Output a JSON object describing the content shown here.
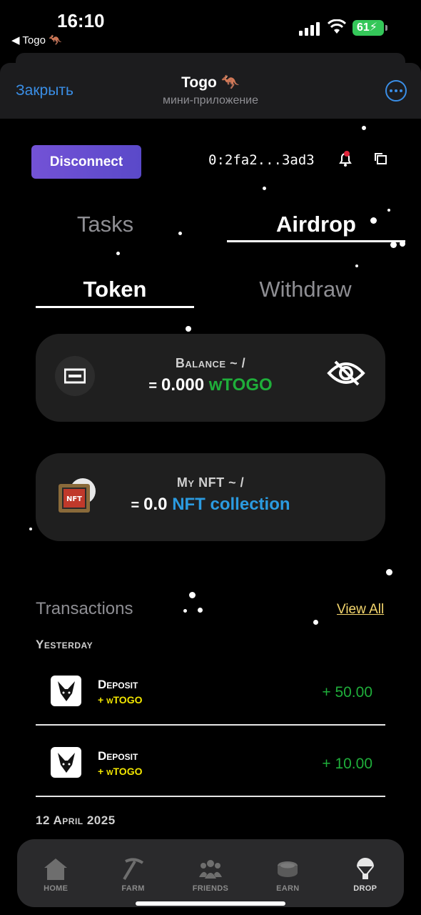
{
  "status_bar": {
    "time": "16:10",
    "back_app": "◀ Togo 🦘",
    "battery": "61"
  },
  "header": {
    "close_label": "Закрыть",
    "title": "Togo 🦘",
    "subtitle": "мини-приложение"
  },
  "wallet": {
    "disconnect_label": "Disconnect",
    "address": "0:2fa2...3ad3"
  },
  "tabs": {
    "tasks": "Tasks",
    "airdrop": "Airdrop"
  },
  "subtabs": {
    "token": "Token",
    "withdraw": "Withdraw"
  },
  "balance_card": {
    "label": "Balance ~ /",
    "eq": "=",
    "amount": "0.000",
    "unit": "wTOGO"
  },
  "nft_card": {
    "label": "My NFT ~ /",
    "eq": "=",
    "amount": "0.0",
    "unit": "NFT collection",
    "icon_text": "NFT"
  },
  "transactions": {
    "title": "Transactions",
    "view_all": "View All",
    "groups": [
      {
        "label": "Yesterday",
        "items": [
          {
            "name": "Deposit",
            "sub": "+ wTOGO",
            "amount": "+ 50.00"
          },
          {
            "name": "Deposit",
            "sub": "+ wTOGO",
            "amount": "+ 10.00"
          }
        ]
      },
      {
        "label": "12 April 2025",
        "items": []
      }
    ]
  },
  "nav": {
    "items": [
      {
        "label": "HOME",
        "icon": "home-icon"
      },
      {
        "label": "FARM",
        "icon": "pickaxe-icon"
      },
      {
        "label": "FRIENDS",
        "icon": "friends-icon"
      },
      {
        "label": "EARN",
        "icon": "coins-icon"
      },
      {
        "label": "DROP",
        "icon": "parachute-icon"
      }
    ]
  },
  "colors": {
    "accent_blue": "#3a8ee6",
    "token_green": "#1fae3a",
    "nft_blue": "#2b9be0",
    "deposit_yellow": "#f2e600",
    "link_yellow": "#f5d76e"
  }
}
